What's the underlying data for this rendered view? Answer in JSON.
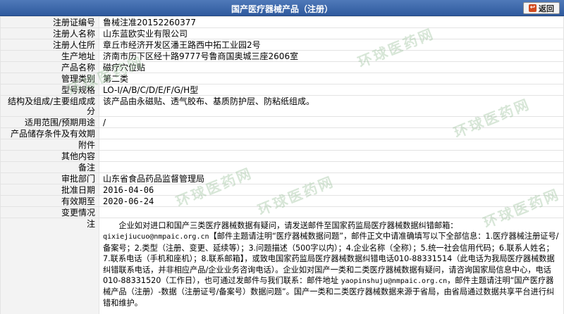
{
  "header": {
    "title": "国产医疗器械产品（注册）",
    "back_label": "返回",
    "back_icon": "back-arrow-icon",
    "accent": "#2f5a9e"
  },
  "rows": [
    {
      "label": "注册证编号",
      "value": "鲁械注准20152260377",
      "mono": false
    },
    {
      "label": "注册人名称",
      "value": "山东蓝欧实业有限公司",
      "mono": false
    },
    {
      "label": "注册人住所",
      "value": "章丘市经济开发区潘王路西中拓工业园2号",
      "mono": false
    },
    {
      "label": "生产地址",
      "value": "济南市历下区经十路9777号鲁商国奥城三座2606室",
      "mono": false
    },
    {
      "label": "产品名称",
      "value": "磁疗穴位贴",
      "mono": false
    },
    {
      "label": "管理类别",
      "value": "第二类",
      "mono": false
    },
    {
      "label": "型号规格",
      "value": "LO-I/A/B/C/D/E/F/G/H型",
      "mono": false
    },
    {
      "label": "结构及组成/主要组成成分",
      "value": "该产品由永磁贴、透气胶布、基质防护层、防粘纸组成。",
      "mono": false
    },
    {
      "label": "适用范围/预期用途",
      "value": "/",
      "mono": false
    },
    {
      "label": "产品储存条件及有效期",
      "value": "",
      "mono": false
    },
    {
      "label": "附件",
      "value": "",
      "mono": false
    },
    {
      "label": "其他内容",
      "value": "",
      "mono": false
    },
    {
      "label": "备注",
      "value": "",
      "mono": false
    },
    {
      "label": "审批部门",
      "value": "山东省食品药品监督管理局",
      "mono": false
    },
    {
      "label": "批准日期",
      "value": "2016-04-06",
      "mono": true
    },
    {
      "label": "有效期至",
      "value": "2020-06-24",
      "mono": true
    },
    {
      "label": "变更情况",
      "value": "",
      "mono": false
    }
  ],
  "note": {
    "label": "注",
    "p1": "企业如对进口和国产三类医疗器械数据有疑问，请发送邮件至国家药监局医疗器械数据纠错邮箱：",
    "email1": "qixiejiucuo@nmpaic.org.cn",
    "p2": "【邮件主题请注明“医疗器械数据问题”，邮件正文中请准确填写以下全部信息：1.医疗器械注册证号/备案号；2.类型（注册、变更、延续等）；3.问题描述（500字以内）；4.企业名称（全称）；5.统一社会信用代码；6.联系人姓名；7.联系电话（手机和座机）；8.联系邮箱】，或致电国家药监局医疗器械数据纠错电话010-88331514（此电话为我局医疗器械数据纠错联系电话，并非相应产品/企业业务咨询电话）。企业如对国产一类和二类医疗器械数据有疑问，请咨询国家局信息中心，电话010-88331520（工作日），也可通过发邮件与我们联系：邮件地址",
    "email2": "yaopinshuju@nmpaic.org.cn",
    "p3": "，邮件主题请注明“国产医疗器械产品（注册）-数据（注册证号/备案号）数据问题”。国产一类和二类医疗器械数据来源于省局，由省局通过数据共享平台进行纠错和维护。"
  },
  "watermark": "环球医药网"
}
